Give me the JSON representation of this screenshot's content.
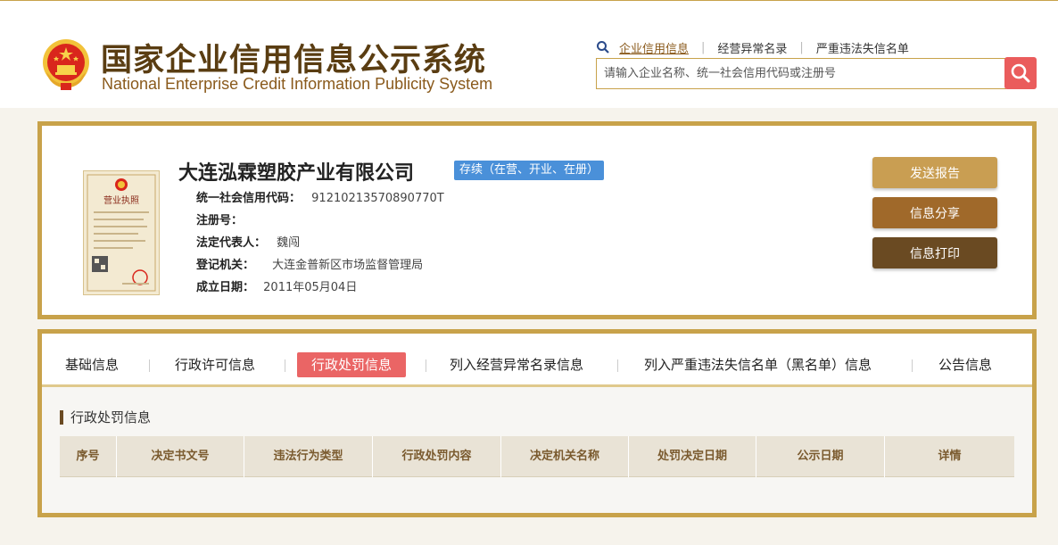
{
  "header": {
    "title_cn": "国家企业信用信息公示系统",
    "title_en": "National Enterprise Credit Information Publicity System",
    "links": [
      "企业信用信息",
      "经营异常名录",
      "严重违法失信名单"
    ],
    "search_placeholder": "请输入企业名称、统一社会信用代码或注册号",
    "search_icon": "search-icon"
  },
  "company": {
    "name": "大连泓霖塑胶产业有限公司",
    "status": "存续（在营、开业、在册）",
    "license_title": "营业执照",
    "fields": [
      {
        "label": "统一社会信用代码：",
        "value": "91210213570890770T"
      },
      {
        "label": "注册号：",
        "value": ""
      },
      {
        "label": "法定代表人：",
        "value": "魏闯"
      },
      {
        "label": "登记机关：",
        "value": "大连金普新区市场监督管理局"
      },
      {
        "label": "成立日期：",
        "value": "2011年05月04日"
      }
    ],
    "buttons": {
      "send": "发送报告",
      "share": "信息分享",
      "print": "信息打印"
    }
  },
  "tabs": [
    "基础信息",
    "行政许可信息",
    "行政处罚信息",
    "列入经营异常名录信息",
    "列入严重违法失信名单（黑名单）信息",
    "公告信息"
  ],
  "active_tab": "行政处罚信息",
  "section": {
    "title": "行政处罚信息",
    "columns": [
      "序号",
      "决定书文号",
      "违法行为类型",
      "行政处罚内容",
      "决定机关名称",
      "处罚决定日期",
      "公示日期",
      "详情"
    ]
  },
  "colors": {
    "gold_border": "#c8a24a",
    "active_tab": "#ea6565",
    "status_badge": "#4a90d9",
    "search_button": "#ea5c5c"
  }
}
